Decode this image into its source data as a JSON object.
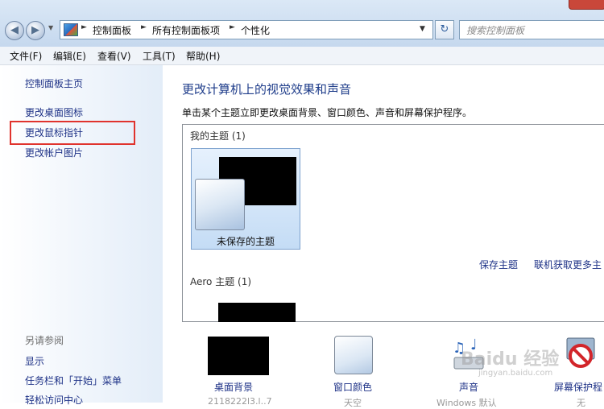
{
  "address": {
    "crumbs": [
      "控制面板",
      "所有控制面板项",
      "个性化"
    ],
    "search_placeholder": "搜索控制面板"
  },
  "menu": [
    "文件(F)",
    "编辑(E)",
    "查看(V)",
    "工具(T)",
    "帮助(H)"
  ],
  "sidebar": {
    "home": "控制面板主页",
    "links": [
      "更改桌面图标",
      "更改鼠标指针",
      "更改帐户图片"
    ],
    "see_also": "另请参阅",
    "see_also_links": [
      "显示",
      "任务栏和「开始」菜单",
      "轻松访问中心"
    ]
  },
  "main": {
    "title": "更改计算机上的视觉效果和声音",
    "subtitle": "单击某个主题立即更改桌面背景、窗口颜色、声音和屏幕保护程序。",
    "my_themes": "我的主题 (1)",
    "unsaved_theme": "未保存的主题",
    "save_theme": "保存主题",
    "get_more": "联机获取更多主",
    "aero_themes": "Aero 主题 (1)"
  },
  "bottom": {
    "desktop_bg": "桌面背景",
    "window_color": "窗口颜色",
    "sound": "声音",
    "screensaver": "屏幕保护程",
    "sub_values": [
      "2118222l3.l..7",
      "天空",
      "Windows 默认",
      "无"
    ]
  },
  "watermark": {
    "text": "Baidu 经验",
    "url": "jingyan.baidu.com"
  },
  "colors": {
    "link": "#1e3287",
    "title": "#1e3c8a",
    "highlight_border": "#e0332d"
  }
}
